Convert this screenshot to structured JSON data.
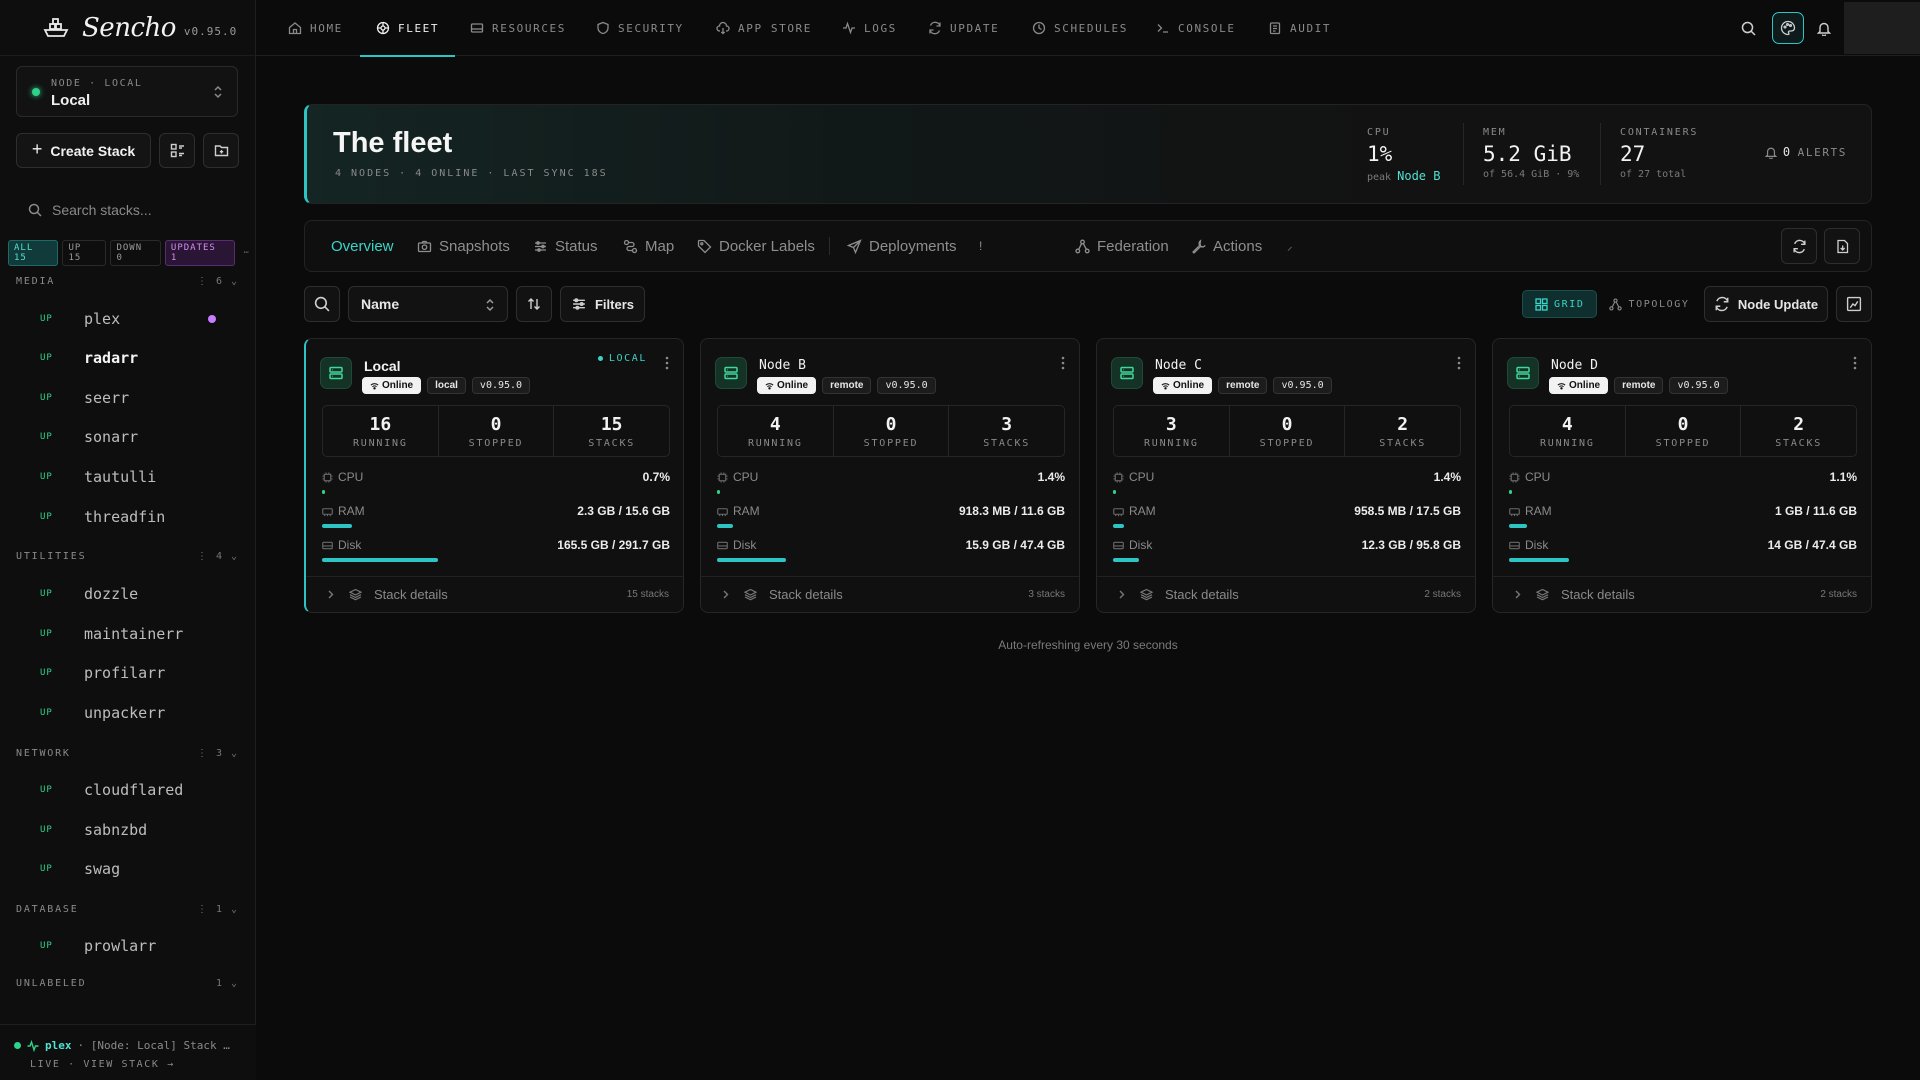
{
  "brand": {
    "name": "Sencho",
    "version": "v0.95.0"
  },
  "node_selector": {
    "label": "NODE · LOCAL",
    "value": "Local"
  },
  "sidebar": {
    "create_label": "Create Stack",
    "search_placeholder": "Search stacks...",
    "filters": {
      "all": "ALL 15",
      "up": "UP 15",
      "down": "DOWN 0",
      "updates": "UPDATES 1",
      "more": "⋯"
    },
    "groups": [
      {
        "name": "MEDIA",
        "count": "6",
        "items": [
          {
            "status": "UP",
            "name": "plex"
          },
          {
            "status": "UP",
            "name": "radarr"
          },
          {
            "status": "UP",
            "name": "seerr"
          },
          {
            "status": "UP",
            "name": "sonarr"
          },
          {
            "status": "UP",
            "name": "tautulli"
          },
          {
            "status": "UP",
            "name": "threadfin"
          }
        ]
      },
      {
        "name": "UTILITIES",
        "count": "4",
        "items": [
          {
            "status": "UP",
            "name": "dozzle"
          },
          {
            "status": "UP",
            "name": "maintainerr"
          },
          {
            "status": "UP",
            "name": "profilarr"
          },
          {
            "status": "UP",
            "name": "unpackerr"
          }
        ]
      },
      {
        "name": "NETWORK",
        "count": "3",
        "items": [
          {
            "status": "UP",
            "name": "cloudflared"
          },
          {
            "status": "UP",
            "name": "sabnzbd"
          },
          {
            "status": "UP",
            "name": "swag"
          }
        ]
      },
      {
        "name": "DATABASE",
        "count": "1",
        "items": [
          {
            "status": "UP",
            "name": "prowlarr"
          }
        ]
      },
      {
        "name": "UNLABELED",
        "count": "1",
        "items": []
      }
    ],
    "activity": {
      "stack": "plex",
      "text": "· [Node: Local] Stack …",
      "sub": "LIVE · VIEW STACK →"
    }
  },
  "nav": {
    "tabs": [
      "HOME",
      "FLEET",
      "RESOURCES",
      "SECURITY",
      "APP STORE",
      "LOGS",
      "UPDATE",
      "SCHEDULES",
      "CONSOLE",
      "AUDIT"
    ],
    "active": "FLEET"
  },
  "hero": {
    "title": "The fleet",
    "subtitle": "4 NODES · 4 ONLINE · LAST SYNC 18S",
    "cpu": {
      "label": "CPU",
      "value": "1%",
      "sub_prefix": "peak",
      "sub_highlight": "Node B"
    },
    "mem": {
      "label": "MEM",
      "value": "5.2 GiB",
      "sub": "of 56.4 GiB · 9%"
    },
    "containers": {
      "label": "CONTAINERS",
      "value": "27",
      "sub": "of 27 total"
    },
    "alerts": {
      "count": "0",
      "label": "ALERTS"
    }
  },
  "subtabs": {
    "overview": "Overview",
    "snapshots": "Snapshots",
    "status": "Status",
    "map": "Map",
    "labels": "Docker Labels",
    "deployments": "Deployments",
    "federation": "Federation",
    "actions": "Actions"
  },
  "toolbar": {
    "sort_value": "Name",
    "filters_label": "Filters",
    "grid_label": "GRID",
    "topology_label": "TOPOLOGY",
    "node_update_label": "Node Update"
  },
  "cards": [
    {
      "name": "Local",
      "online": "Online",
      "type": "local",
      "version": "v0.95.0",
      "tag": "LOCAL",
      "running": "16",
      "stopped": "0",
      "stacks": "15",
      "cpu": "0.7%",
      "ram": "2.3 GB / 15.6 GB",
      "disk": "165.5 GB / 291.7 GB",
      "cpu_pct": 0.7,
      "ram_pct": 14.7,
      "disk_pct": 56.7,
      "footer": "15 stacks"
    },
    {
      "name": "Node B",
      "online": "Online",
      "type": "remote",
      "version": "v0.95.0",
      "running": "4",
      "stopped": "0",
      "stacks": "3",
      "cpu": "1.4%",
      "ram": "918.3 MB / 11.6 GB",
      "disk": "15.9 GB / 47.4 GB",
      "cpu_pct": 1.4,
      "ram_pct": 7.9,
      "disk_pct": 33.5,
      "footer": "3 stacks"
    },
    {
      "name": "Node C",
      "online": "Online",
      "type": "remote",
      "version": "v0.95.0",
      "running": "3",
      "stopped": "0",
      "stacks": "2",
      "cpu": "1.4%",
      "ram": "958.5 MB / 17.5 GB",
      "disk": "12.3 GB / 95.8 GB",
      "cpu_pct": 1.4,
      "ram_pct": 5.5,
      "disk_pct": 12.8,
      "footer": "2 stacks"
    },
    {
      "name": "Node D",
      "online": "Online",
      "type": "remote",
      "version": "v0.95.0",
      "running": "4",
      "stopped": "0",
      "stacks": "2",
      "cpu": "1.1%",
      "ram": "1 GB / 11.6 GB",
      "disk": "14 GB / 47.4 GB",
      "cpu_pct": 1.1,
      "ram_pct": 8.6,
      "disk_pct": 29.5,
      "footer": "2 stacks"
    }
  ],
  "labels": {
    "running": "RUNNING",
    "stopped": "STOPPED",
    "stacks": "STACKS",
    "cpu": "CPU",
    "ram": "RAM",
    "disk": "Disk",
    "stack_details": "Stack details"
  },
  "auto_refresh": "Auto-refreshing every 30 seconds"
}
